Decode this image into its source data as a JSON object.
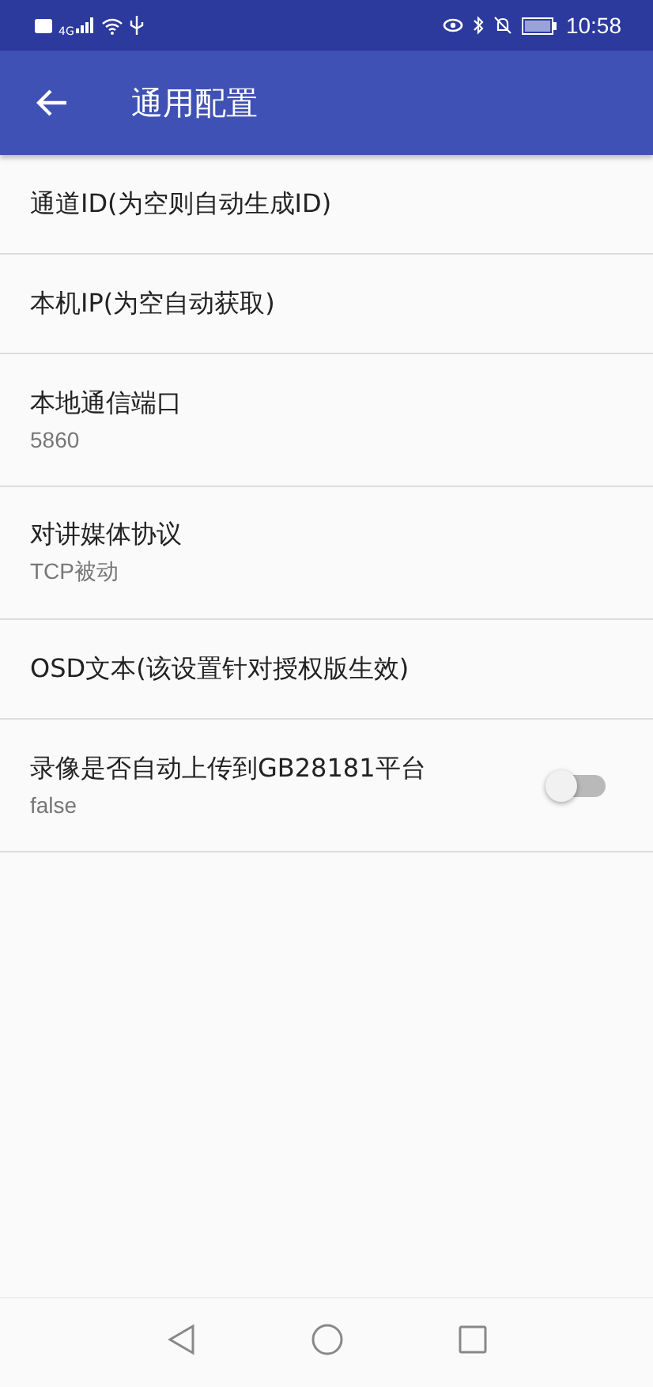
{
  "status_bar": {
    "network": "4G",
    "time": "10:58"
  },
  "app_bar": {
    "title": "通用配置"
  },
  "settings": [
    {
      "kind": "text",
      "title": "通道ID(为空则自动生成ID)"
    },
    {
      "kind": "text",
      "title": "本机IP(为空自动获取)"
    },
    {
      "kind": "text",
      "title": "本地通信端口",
      "summary": "5860"
    },
    {
      "kind": "text",
      "title": "对讲媒体协议",
      "summary": "TCP被动"
    },
    {
      "kind": "text",
      "title": "OSD文本(该设置针对授权版生效)"
    },
    {
      "kind": "switch",
      "title": "录像是否自动上传到GB28181平台",
      "summary": "false",
      "on": false
    }
  ]
}
